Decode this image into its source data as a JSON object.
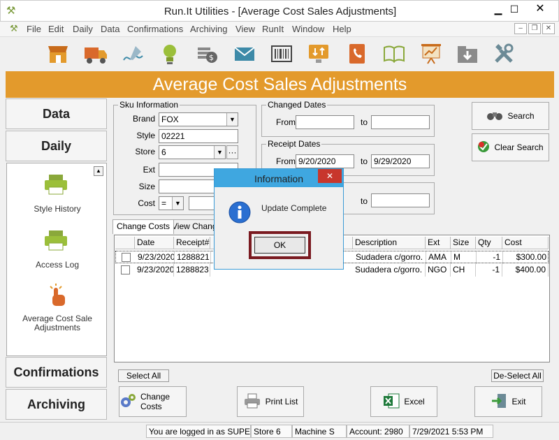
{
  "window": {
    "title": "Run.It Utilities - [Average Cost Sales Adjustments]"
  },
  "menu": [
    "File",
    "Edit",
    "Daily",
    "Data",
    "Confirmations",
    "Archiving",
    "View",
    "RunIt",
    "Window",
    "Help"
  ],
  "toolbar_icons": [
    "store-icon",
    "truck-icon",
    "signature-icon",
    "lightbulb-icon",
    "money-icon",
    "mail-icon",
    "barcode-icon",
    "transfer-icon",
    "phone-book-icon",
    "book-icon",
    "presentation-icon",
    "download-box-icon",
    "tools-icon"
  ],
  "banner": {
    "title": "Average Cost Sales Adjustments"
  },
  "nav": {
    "data": "Data",
    "daily": "Daily",
    "items": [
      {
        "label": "Style History",
        "icon": "printer-icon"
      },
      {
        "label": "Access Log",
        "icon": "printer-icon"
      },
      {
        "label": "Average Cost Sale Adjustments",
        "icon": "hand-pointer-icon"
      }
    ],
    "confirmations": "Confirmations",
    "archiving": "Archiving"
  },
  "sku": {
    "group_title": "Sku Information",
    "brand_label": "Brand",
    "brand_value": "FOX",
    "style_label": "Style",
    "style_value": "02221",
    "store_label": "Store",
    "store_value": "6",
    "ext_label": "Ext",
    "ext_value": "",
    "size_label": "Size",
    "size_value": "",
    "cost_label": "Cost",
    "cost_op": "="
  },
  "changed_dates": {
    "group_title": "Changed Dates",
    "from_label": "From",
    "from_value": "",
    "to_label": "to",
    "to_value": ""
  },
  "receipt_dates": {
    "group_title": "Receipt Dates",
    "from_label": "From",
    "from_value": "9/20/2020",
    "to_label": "to",
    "to_value": "9/29/2020"
  },
  "third_dates": {
    "to_label": "to",
    "to_value": ""
  },
  "search_button": "Search",
  "clear_search_button": "Clear Search",
  "tabs": [
    "Change Costs",
    "View Change"
  ],
  "grid": {
    "columns": [
      "Date",
      "Receipt#",
      "Description",
      "Ext",
      "Size",
      "Qty",
      "Cost"
    ],
    "rows": [
      {
        "date": "9/23/2020",
        "receipt": "1288821",
        "description": "Sudadera c/gorro.",
        "ext": "AMA",
        "size": "M",
        "qty": "-1",
        "cost": "$300.00"
      },
      {
        "date": "9/23/2020",
        "receipt": "1288823",
        "description": "Sudadera c/gorro.",
        "ext": "NGO",
        "size": "CH",
        "qty": "-1",
        "cost": "$400.00"
      }
    ]
  },
  "select_all": "Select All",
  "deselect_all": "De-Select All",
  "actions": {
    "change_costs": "Change Costs",
    "print_list": "Print List",
    "excel": "Excel",
    "exit": "Exit"
  },
  "dialog": {
    "title": "Information",
    "message": "Update Complete",
    "ok": "OK"
  },
  "status": {
    "user": "You are logged in as SUPER",
    "store": "Store 6",
    "machine": "Machine S",
    "account": "Account: 2980",
    "datetime": "7/29/2021 5:53 PM"
  }
}
